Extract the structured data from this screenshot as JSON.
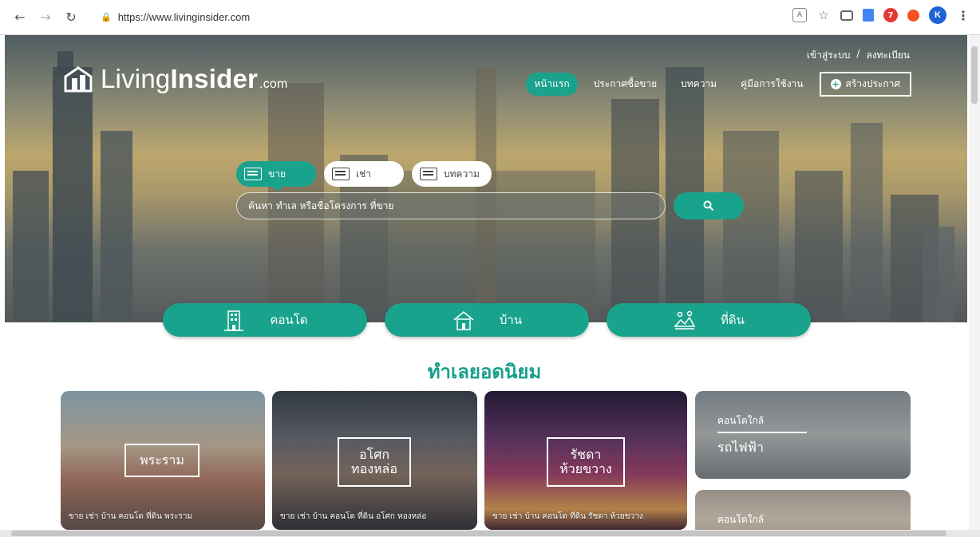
{
  "browser": {
    "url": "https://www.livinginsider.com",
    "profile_initial": "K",
    "badge_count": "7"
  },
  "brand": {
    "name_light": "Living",
    "name_bold": "Insider",
    "name_suffix": ".com"
  },
  "auth": {
    "login": "เข้าสู่ระบบ",
    "separator": "/",
    "register": "ลงทะเบียน"
  },
  "nav": {
    "items": [
      {
        "label": "หน้าแรก",
        "active": true
      },
      {
        "label": "ประกาศซื้อขาย",
        "active": false
      },
      {
        "label": "บทความ",
        "active": false
      },
      {
        "label": "คู่มือการใช้งาน",
        "active": false
      }
    ],
    "create_label": "สร้างประกาศ"
  },
  "search": {
    "tabs": [
      {
        "label": "ขาย",
        "active": true
      },
      {
        "label": "เช่า",
        "active": false
      },
      {
        "label": "บทความ",
        "active": false
      }
    ],
    "placeholder": "ค้นหา ทำเล หรือชื่อโครงการ ที่ขาย"
  },
  "categories": [
    {
      "label": "คอนโด",
      "icon": "condo-building-icon"
    },
    {
      "label": "บ้าน",
      "icon": "house-icon"
    },
    {
      "label": "ที่ดิน",
      "icon": "land-icon"
    }
  ],
  "popular": {
    "title": "ทำเลยอดนิยม",
    "cards": [
      {
        "title_lines": [
          "พระราม"
        ],
        "caption": "ขาย เช่า บ้าน คอนโด ที่ดิน พระราม"
      },
      {
        "title_lines": [
          "อโศก",
          "ทองหล่อ"
        ],
        "caption": "ขาย เช่า บ้าน คอนโด ที่ดิน อโศก ทองหล่อ"
      },
      {
        "title_lines": [
          "รัชดา",
          "ห้วยขวาง"
        ],
        "caption": "ขาย เช่า บ้าน คอนโด ที่ดิน รัชดา ห้วยขวาง"
      }
    ],
    "near": [
      {
        "small": "คอนโดใกล้",
        "big": "รถไฟฟ้า"
      },
      {
        "small": "คอนโดใกล้",
        "big": ""
      }
    ]
  },
  "colors": {
    "accent": "#1aa38c",
    "title": "#17a08b"
  }
}
